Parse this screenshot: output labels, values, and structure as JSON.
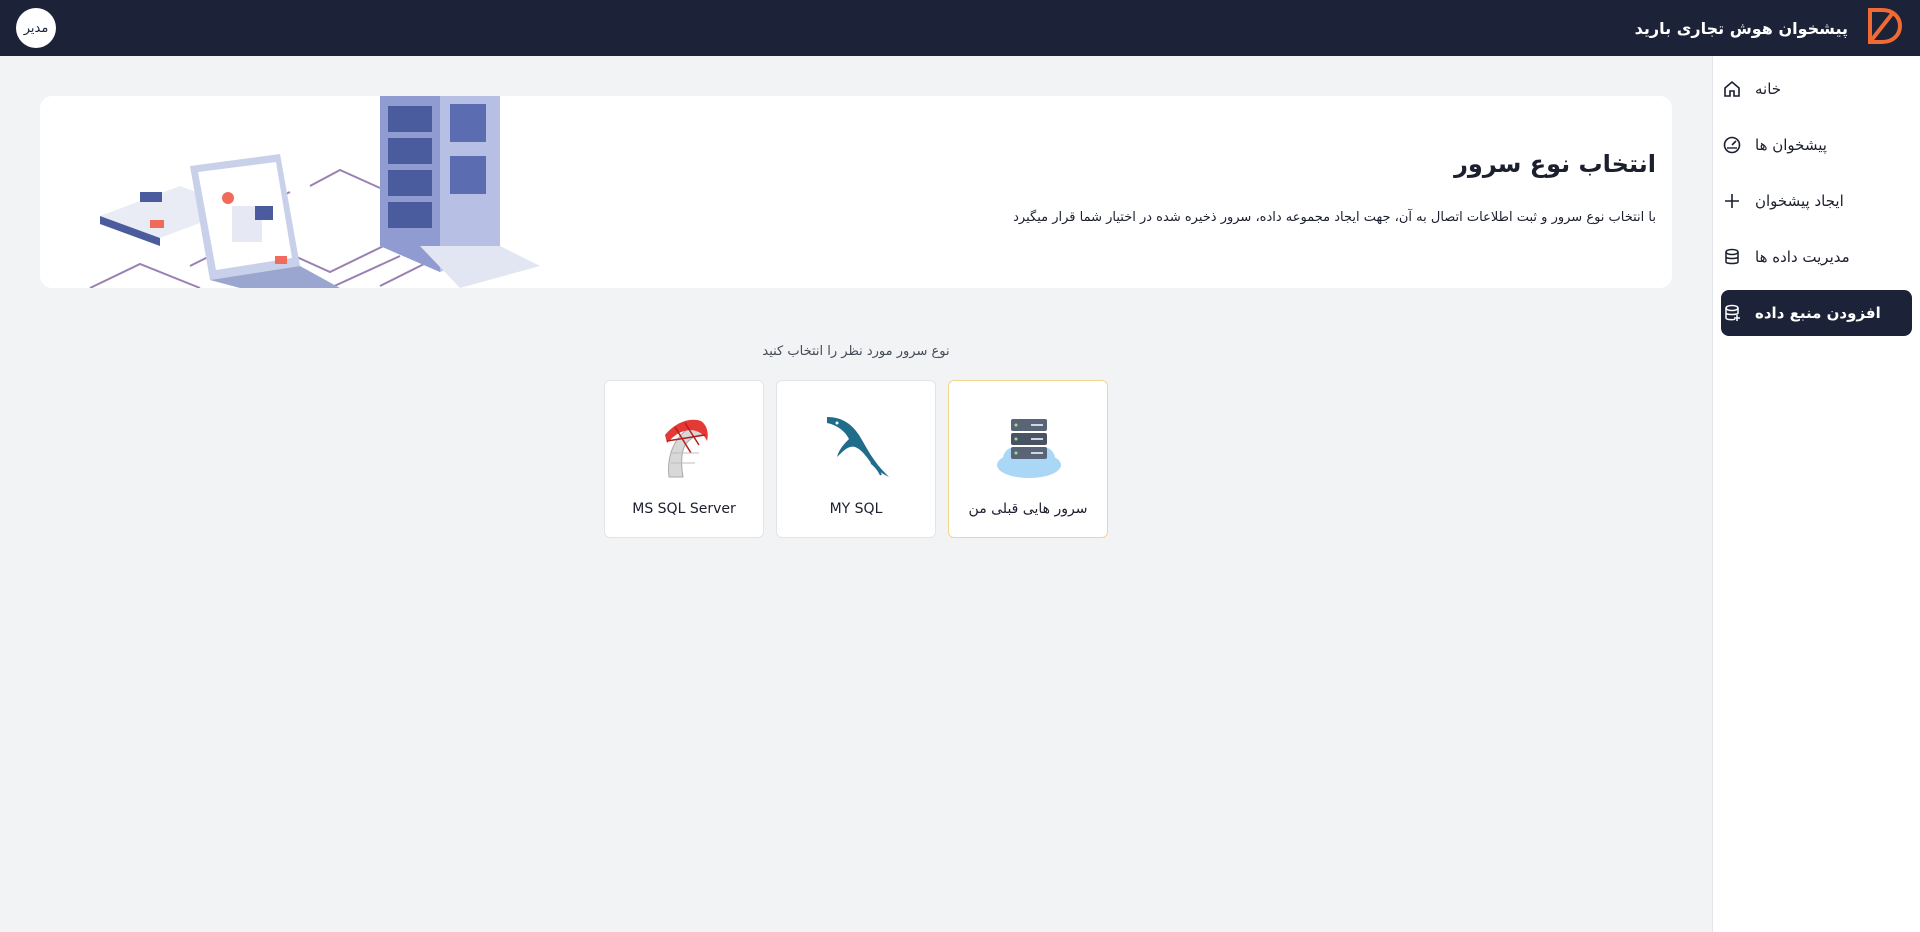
{
  "header": {
    "brand_title": "پیشخوان هوش تجاری بارید",
    "avatar_label": "مدیر"
  },
  "sidebar": {
    "items": [
      {
        "label": "خانه",
        "icon": "home-icon"
      },
      {
        "label": "پیشخوان ها",
        "icon": "dashboard-icon"
      },
      {
        "label": "ایجاد پیشخوان",
        "icon": "plus-icon"
      },
      {
        "label": "مدیریت داده ها",
        "icon": "database-icon"
      },
      {
        "label": "افزودن منبع داده",
        "icon": "add-datasource-icon",
        "active": true
      }
    ]
  },
  "hero": {
    "title": "انتخاب نوع سرور",
    "description": "با انتخاب نوع سرور و ثبت اطلاعات اتصال به آن، جهت ایجاد مجموعه داده، سرور ذخیره شده در اختیار شما قرار میگیرد"
  },
  "server_select": {
    "label": "نوع سرور مورد نظر را انتخاب کنید",
    "cards": [
      {
        "label": "سرور هایی قبلی من",
        "icon": "cloud-server-icon",
        "selected": true
      },
      {
        "label": "MY SQL",
        "icon": "mysql-dolphin-icon"
      },
      {
        "label": "MS SQL Server",
        "icon": "mssql-server-icon"
      }
    ]
  },
  "colors": {
    "topbar": "#1c2237",
    "brand_accent": "#f26a33",
    "selected_card_border": "#f3d58d"
  }
}
